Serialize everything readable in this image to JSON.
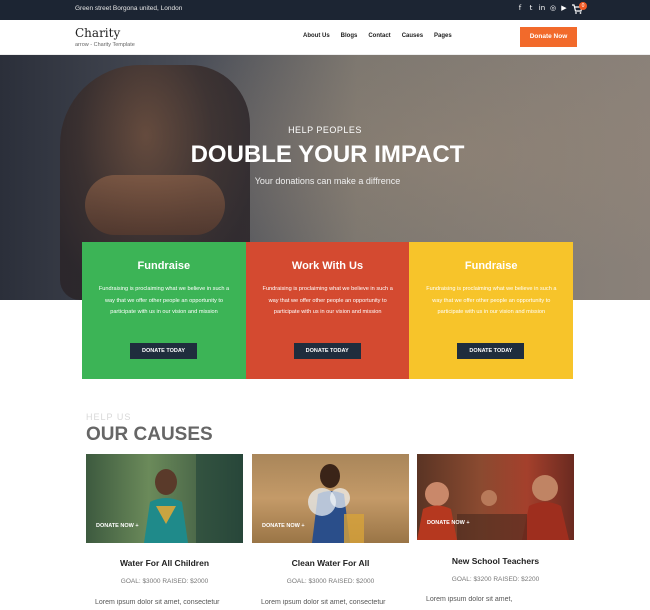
{
  "topbar": {
    "address": "Green street Borgona united, London",
    "social_icons": [
      "facebook-icon",
      "twitter-icon",
      "linkedin-icon",
      "instagram-icon",
      "youtube-icon"
    ],
    "cart_count": "0"
  },
  "header": {
    "logo": "Charity",
    "tagline": "arrow - Charity Template",
    "nav": [
      "About Us",
      "Blogs",
      "Contact",
      "Causes",
      "Pages"
    ],
    "donate_label": "Donate Now"
  },
  "hero": {
    "subtitle": "HELP PEOPLES",
    "title": "DOUBLE YOUR IMPACT",
    "description": "Your donations can make a diffrence"
  },
  "features": [
    {
      "title": "Fundraise",
      "description": "Fundraising is proclaiming what we believe in such a way that we offer other people an opportunity to participate with us in our vision and mission",
      "button": "DONATE TODAY",
      "color": "#3cb456"
    },
    {
      "title": "Work With Us",
      "description": "Fundraising is proclaiming what we believe in such a way that we offer other people an opportunity to participate with us in our vision and mission",
      "button": "DONATE TODAY",
      "color": "#d44a30"
    },
    {
      "title": "Fundraise",
      "description": "Fundraising is proclaiming what we believe in such a way that we offer other people an opportunity to participate with us in our vision and mission",
      "button": "DONATE TODAY",
      "color": "#f7c42a"
    }
  ],
  "causes_section": {
    "kicker": "HELP US",
    "title": "OUR CAUSES"
  },
  "causes": [
    {
      "title": "Water For All Children",
      "goal": "GOAL: $3000 RAISED: $2000",
      "donate_label": "DONATE NOW",
      "excerpt": "Lorem ipsum dolor sit amet, consectetur"
    },
    {
      "title": "Clean Water For All",
      "goal": "GOAL: $3000 RAISED: $2000",
      "donate_label": "DONATE NOW",
      "excerpt": "Lorem ipsum dolor sit amet, consectetur"
    },
    {
      "title": "New School Teachers",
      "goal": "GOAL: $3200 RAISED: $2200",
      "donate_label": "DONATE NOW",
      "excerpt": "Lorem ipsum dolor sit amet,"
    }
  ],
  "colors": {
    "topbar": "#1c2533",
    "accent": "#f26a2b",
    "green": "#3cb456",
    "red": "#d44a30",
    "yellow": "#f7c42a",
    "button_dark": "#1f2d3d"
  }
}
